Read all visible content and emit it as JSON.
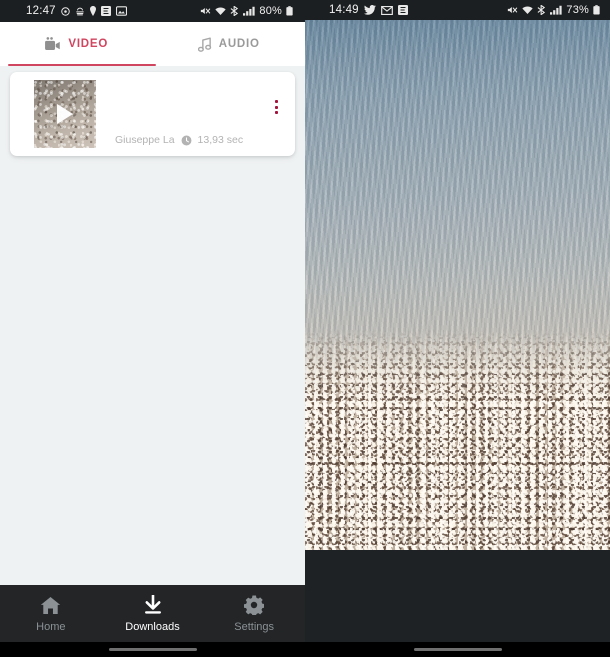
{
  "left_phone": {
    "status_bar": {
      "time": "12:47",
      "battery": "80%",
      "left_icons": [
        "location-icon",
        "weather-icon",
        "pin-icon",
        "app-e-icon",
        "gallery-icon"
      ],
      "right_icons": [
        "mute-icon",
        "wifi-icon",
        "bluetooth-icon",
        "signal-icon",
        "battery-icon"
      ]
    },
    "tabs": [
      {
        "label": "VIDEO",
        "icon": "video-camera-icon",
        "active": true
      },
      {
        "label": "AUDIO",
        "icon": "music-note-icon",
        "active": false
      }
    ],
    "download_item": {
      "thumbnail_icon": "play-icon",
      "author": "Giuseppe La",
      "duration_icon": "clock-icon",
      "duration": "13,93 sec",
      "overflow_icon": "kebab-menu-icon"
    },
    "bottom_nav": [
      {
        "label": "Home",
        "icon": "home-icon",
        "active": false
      },
      {
        "label": "Downloads",
        "icon": "download-icon",
        "active": true
      },
      {
        "label": "Settings",
        "icon": "gear-icon",
        "active": false
      }
    ]
  },
  "right_phone": {
    "status_bar": {
      "time": "14:49",
      "battery": "73%",
      "left_icons": [
        "twitter-icon",
        "gmail-icon",
        "app-e-icon"
      ],
      "right_icons": [
        "mute-icon",
        "wifi-icon",
        "bluetooth-icon",
        "signal-icon",
        "battery-icon"
      ]
    },
    "video": {
      "description": "sea-shore-pebble-beach-video"
    }
  },
  "colors": {
    "accent": "#d0455f",
    "kebab": "#a3123a",
    "app_background": "#eff2f3",
    "nav_background": "#232527",
    "status_background": "#1c1f21",
    "meta_text": "#b3b3b3",
    "inactive_tab": "#9a9a9a"
  }
}
